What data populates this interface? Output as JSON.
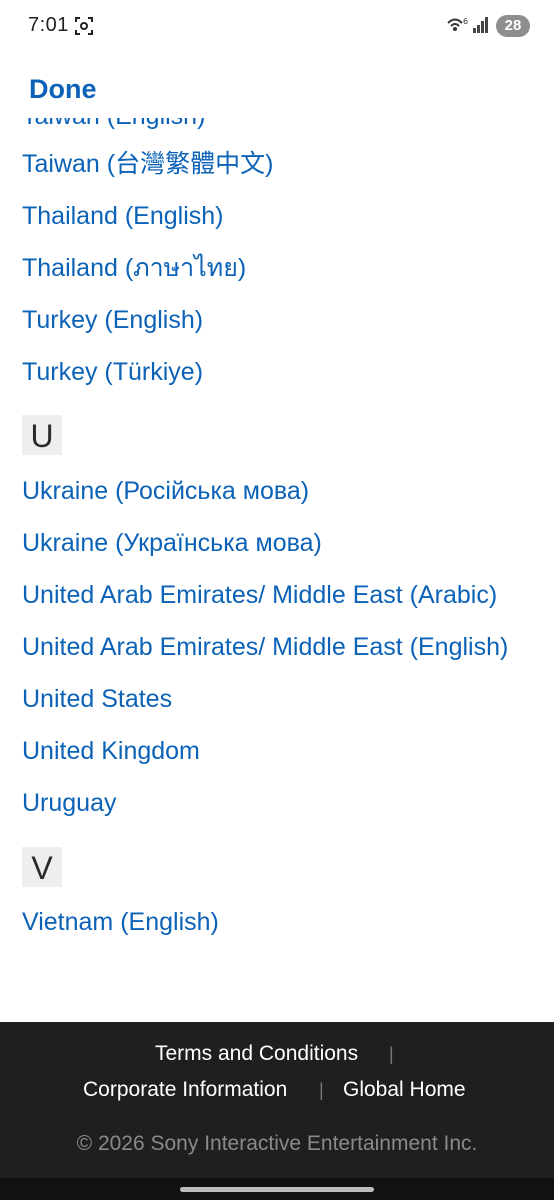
{
  "status_bar": {
    "time": "7:01",
    "battery": "28",
    "icons": [
      "screenshot-icon",
      "wifi-icon",
      "signal-icon"
    ]
  },
  "header": {
    "done_label": "Done"
  },
  "list": {
    "partial_item": "Taiwan (English)",
    "groups": [
      {
        "letter": "",
        "items": [
          "Taiwan (台灣繁體中文)",
          "Thailand (English)",
          "Thailand (ภาษาไทย)",
          "Turkey (English)",
          "Turkey (Türkiye)"
        ]
      },
      {
        "letter": "U",
        "items": [
          "Ukraine (Російська мова)",
          "Ukraine (Українська мова)",
          "United Arab Emirates/ Middle East (Arabic)",
          "United Arab Emirates/ Middle East (English)",
          "United States",
          "United Kingdom",
          "Uruguay"
        ]
      },
      {
        "letter": "V",
        "items": [
          "Vietnam (English)"
        ]
      }
    ]
  },
  "footer": {
    "terms": "Terms and Conditions",
    "corporate": "Corporate Information",
    "global_home": "Global Home",
    "separator": "|",
    "copyright": "© 2026 Sony Interactive Entertainment Inc."
  },
  "colors": {
    "link": "#0b62b7",
    "footer_bg": "#1f1f1f"
  }
}
